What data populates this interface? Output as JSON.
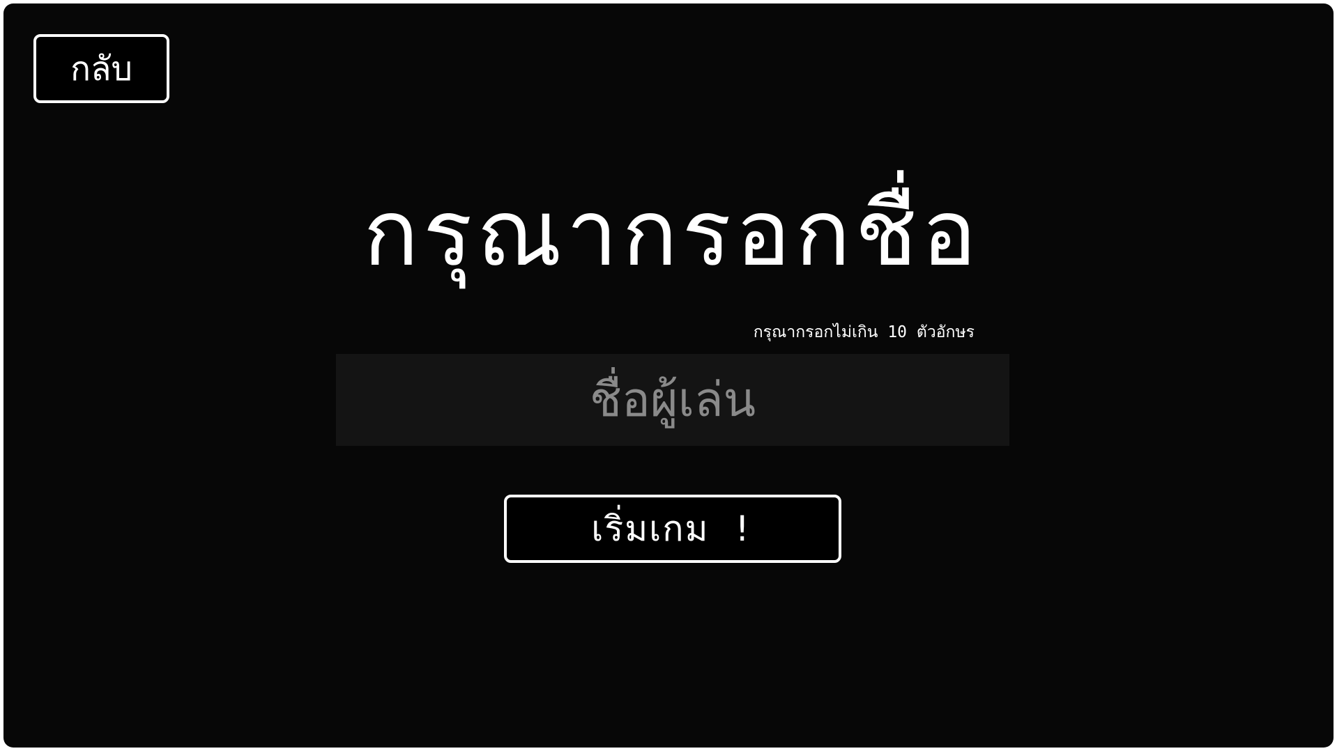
{
  "back_button": {
    "label": "กลับ"
  },
  "title": "กรุณากรอกชื่อ",
  "hint": "กรุณากรอกไม่เกิน 10 ตัวอักษร",
  "name_input": {
    "placeholder": "ชื่อผู้เล่น",
    "value": "",
    "max_length": 10
  },
  "start_button": {
    "label": "เริ่มเกม !"
  },
  "colors": {
    "background": "#070707",
    "foreground": "#ffffff",
    "input_background": "#141414",
    "placeholder": "#8a8a8a"
  }
}
